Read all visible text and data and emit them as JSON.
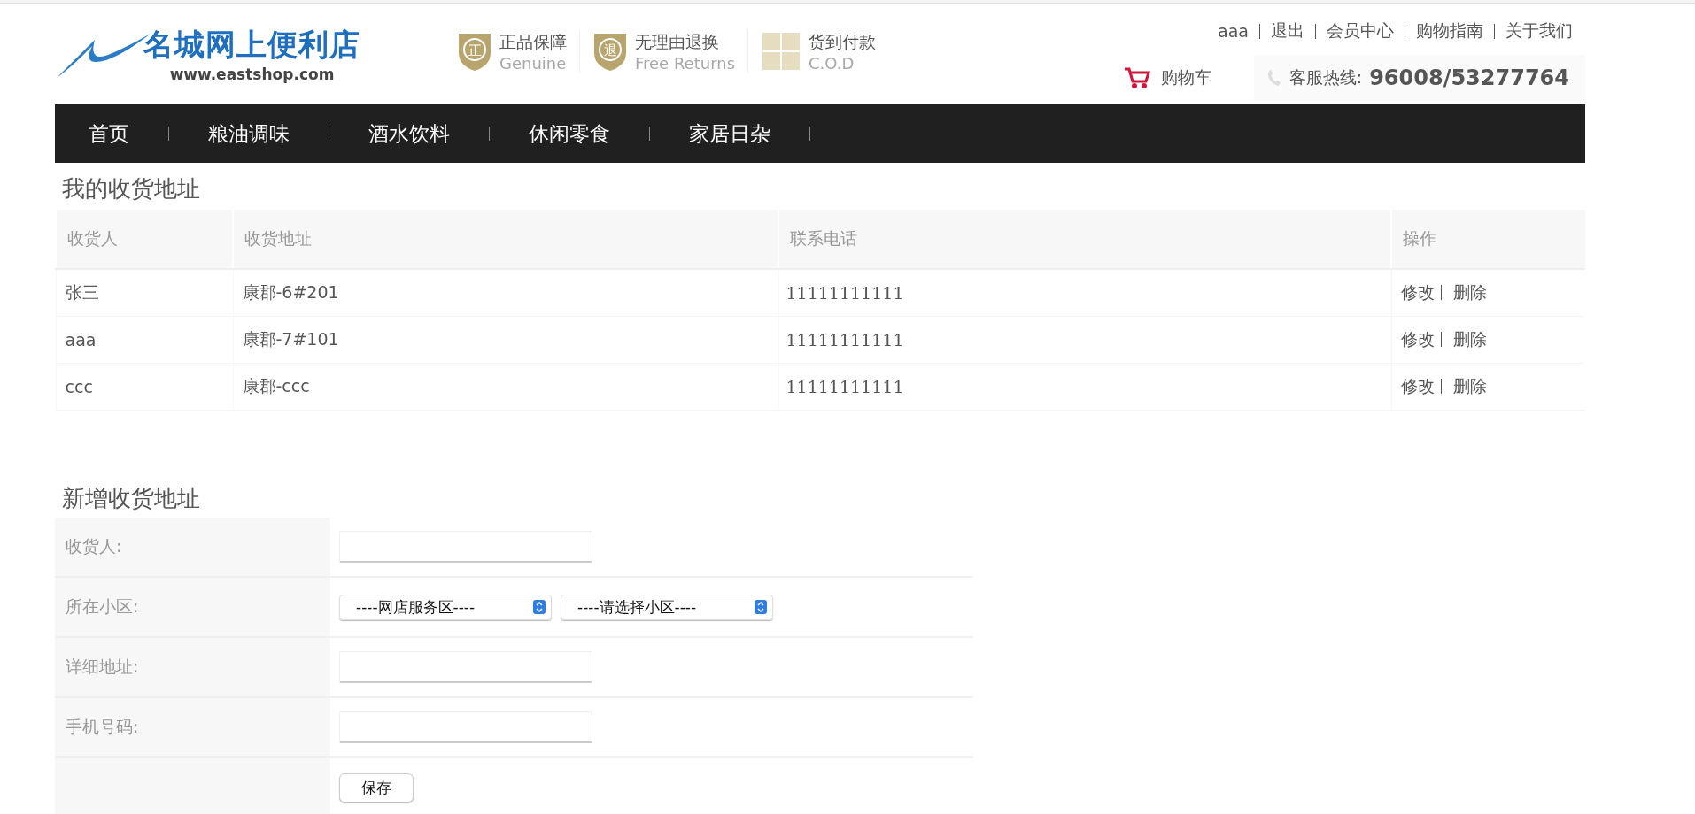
{
  "header": {
    "logo": {
      "name": "名城网上便利店",
      "url": "www.eastshop.com"
    },
    "badges": [
      {
        "kind": "shield",
        "icon_char": "正",
        "title": "正品保障",
        "subtitle": "Genuine"
      },
      {
        "kind": "shield",
        "icon_char": "退",
        "title": "无理由退换",
        "subtitle": "Free Returns"
      },
      {
        "kind": "box",
        "title": "货到付款",
        "subtitle": "C.O.D"
      }
    ],
    "top_links": [
      "aaa",
      "退出",
      "会员中心",
      "购物指南",
      "关于我们"
    ],
    "cart": "购物车",
    "hotline": {
      "label": "客服热线:",
      "number": "96008/53277764"
    }
  },
  "nav": [
    "首页",
    "粮油调味",
    "酒水饮料",
    "休闲零食",
    "家居日杂"
  ],
  "addresses": {
    "title": "我的收货地址",
    "columns": [
      "收货人",
      "收货地址",
      "联系电话",
      "操作"
    ],
    "rows": [
      {
        "name": "张三",
        "address": "康郡-6#201",
        "phone": "11111111111",
        "actions": [
          "修改",
          "删除"
        ]
      },
      {
        "name": "aaa",
        "address": "康郡-7#101",
        "phone": "11111111111",
        "actions": [
          "修改",
          "删除"
        ]
      },
      {
        "name": "ccc",
        "address": "康郡-ccc",
        "phone": "11111111111",
        "actions": [
          "修改",
          "删除"
        ]
      }
    ]
  },
  "new_address": {
    "title": "新增收货地址",
    "fields": [
      {
        "kind": "text",
        "label": "收货人:"
      },
      {
        "kind": "selects",
        "label": "所在小区:",
        "selects": [
          "----网店服务区----",
          "----请选择小区----"
        ]
      },
      {
        "kind": "text",
        "label": "详细地址:"
      },
      {
        "kind": "text",
        "label": "手机号码:"
      },
      {
        "kind": "button",
        "button": "保存"
      }
    ]
  }
}
